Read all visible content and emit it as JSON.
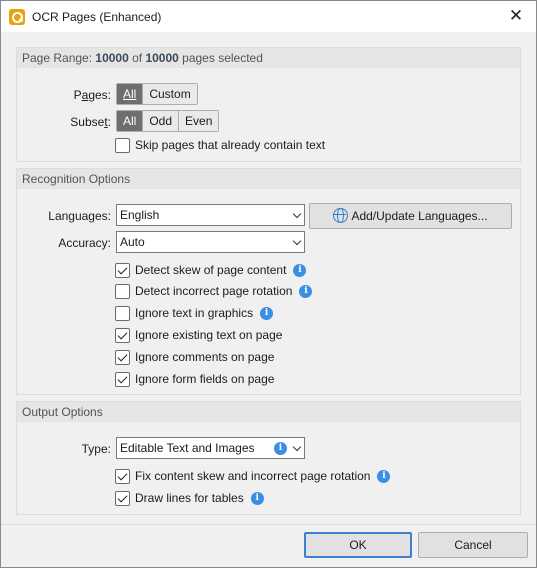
{
  "window": {
    "title": "OCR Pages (Enhanced)",
    "close_glyph": "✕",
    "icon": "ocr-app-icon"
  },
  "page_range": {
    "header_prefix": "Page Range: ",
    "selected": "10000",
    "of": " of ",
    "total": "10000",
    "suffix": " pages selected",
    "pages_label": "Pages:",
    "pages_options": [
      "All",
      "Custom"
    ],
    "pages_selected": "All",
    "subset_label": "Subset:",
    "subset_options": [
      "All",
      "Odd",
      "Even"
    ],
    "subset_selected": "All",
    "skip_label": "Skip pages that already contain text",
    "skip_checked": false
  },
  "recognition": {
    "header": "Recognition Options",
    "languages_label": "Languages:",
    "languages_value": "English",
    "add_languages_button": "Add/Update Languages...",
    "accuracy_label": "Accuracy:",
    "accuracy_value": "Auto",
    "options": [
      {
        "label": "Detect skew of page content",
        "checked": true,
        "info": true
      },
      {
        "label": "Detect incorrect page rotation",
        "checked": false,
        "info": true
      },
      {
        "label": "Ignore text in graphics",
        "checked": false,
        "info": true
      },
      {
        "label": "Ignore existing text on page",
        "checked": true,
        "info": false
      },
      {
        "label": "Ignore comments on page",
        "checked": true,
        "info": false
      },
      {
        "label": "Ignore form fields on page",
        "checked": true,
        "info": false
      }
    ]
  },
  "output": {
    "header": "Output Options",
    "type_label": "Type:",
    "type_value": "Editable Text and Images",
    "options": [
      {
        "label": "Fix content skew and incorrect page rotation",
        "checked": true,
        "info": true
      },
      {
        "label": "Draw lines for tables",
        "checked": true,
        "info": true
      }
    ]
  },
  "footer": {
    "ok": "OK",
    "cancel": "Cancel"
  },
  "info_glyph": "i",
  "colors": {
    "accent": "#3c7fd1",
    "info": "#3a8ee6",
    "selected_segment": "#6e6e6e"
  }
}
